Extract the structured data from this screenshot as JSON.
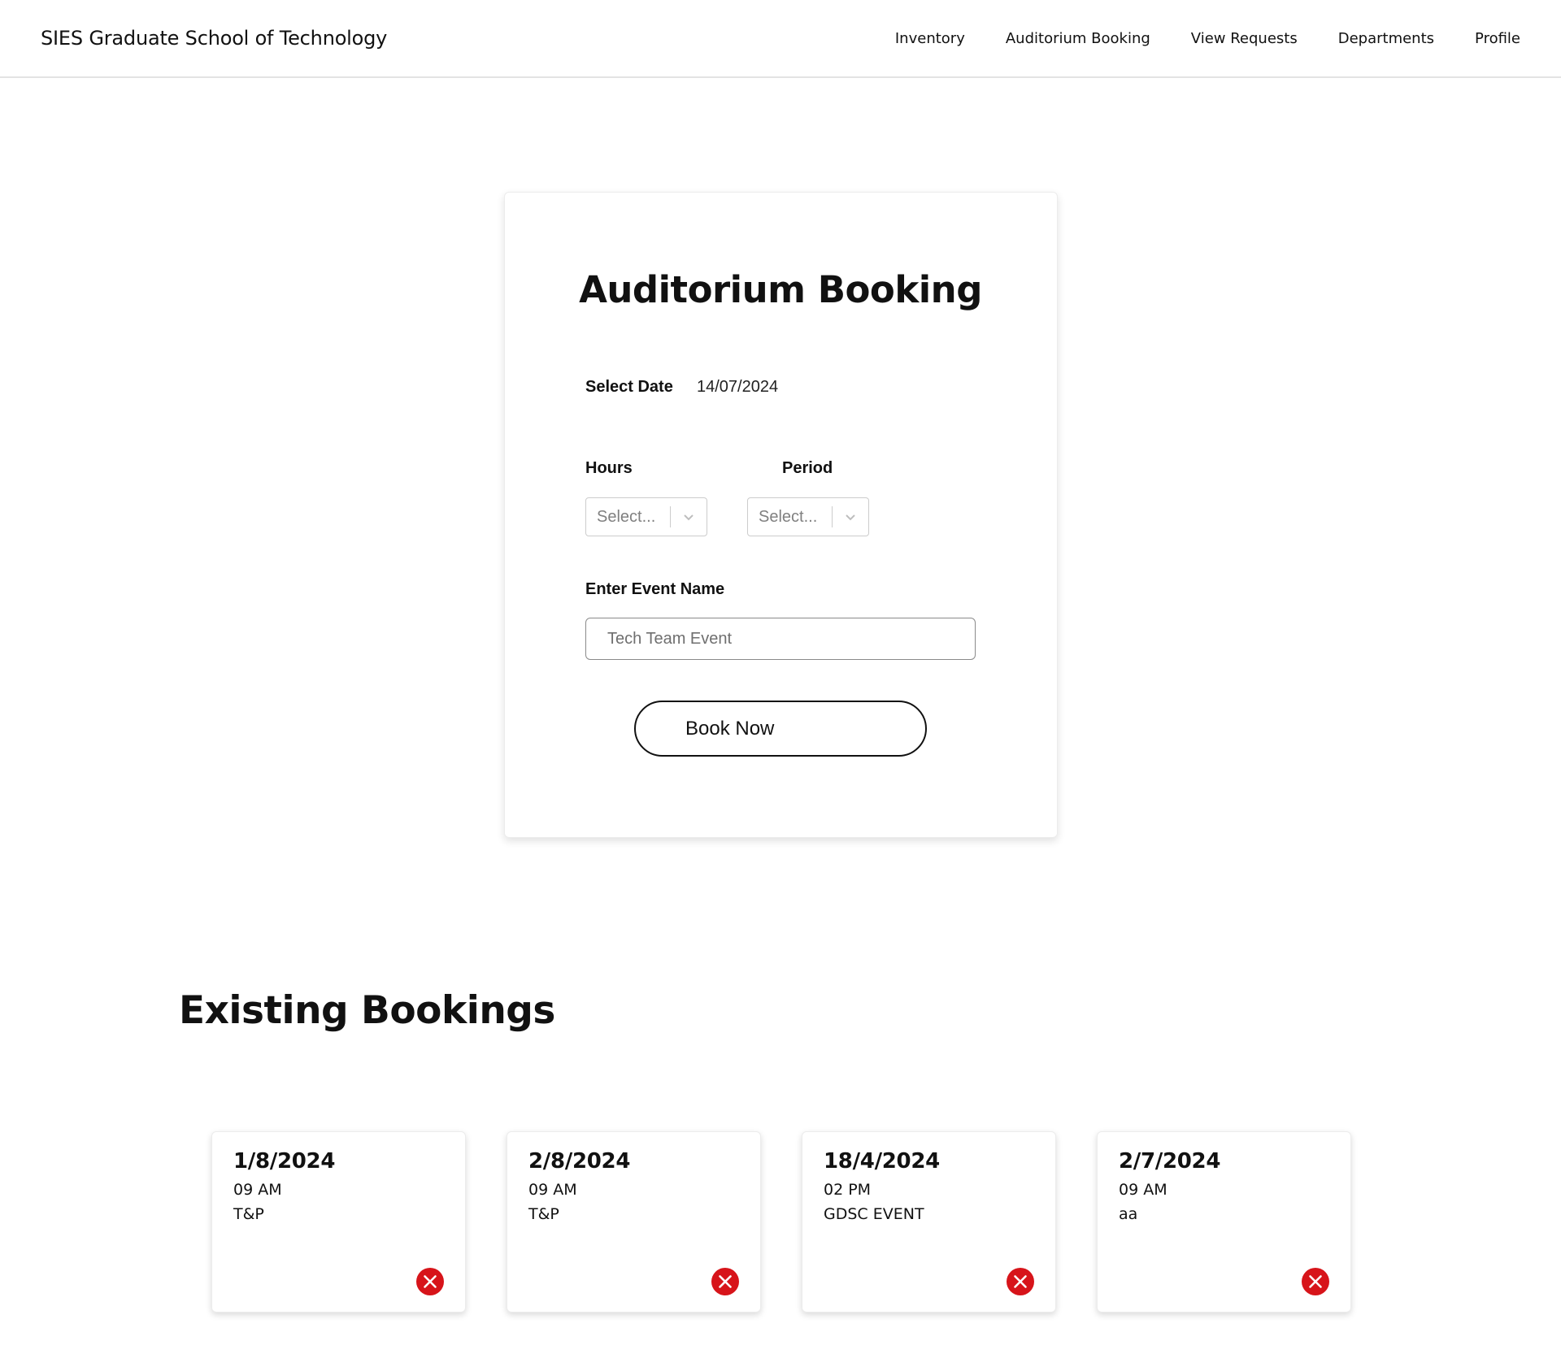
{
  "header": {
    "brand": "SIES Graduate School of Technology",
    "nav": [
      {
        "label": "Inventory"
      },
      {
        "label": "Auditorium Booking"
      },
      {
        "label": "View Requests"
      },
      {
        "label": "Departments"
      },
      {
        "label": "Profile"
      }
    ]
  },
  "booking_form": {
    "title": "Auditorium Booking",
    "date_label": "Select Date",
    "date_value": "14/07/2024",
    "hours_label": "Hours",
    "hours_placeholder": "Select...",
    "period_label": "Period",
    "period_placeholder": "Select...",
    "event_label": "Enter Event Name",
    "event_placeholder": "Tech Team Event",
    "submit_label": "Book Now"
  },
  "existing": {
    "title": "Existing Bookings",
    "bookings": [
      {
        "date": "1/8/2024",
        "time": "09 AM",
        "event": "T&P"
      },
      {
        "date": "2/8/2024",
        "time": "09 AM",
        "event": "T&P"
      },
      {
        "date": "18/4/2024",
        "time": "02 PM",
        "event": "GDSC EVENT"
      },
      {
        "date": "2/7/2024",
        "time": "09 AM",
        "event": "aa"
      }
    ]
  },
  "icons": {
    "dropdown": "chevron-down-icon",
    "delete": "close-circle-icon"
  },
  "colors": {
    "delete_red": "#d7141a",
    "border": "#e3e3e3",
    "text": "#111111"
  }
}
